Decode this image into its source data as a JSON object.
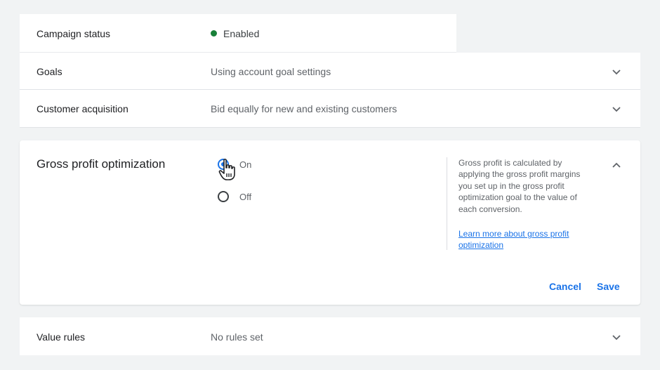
{
  "rows": {
    "campaign_status": {
      "label": "Campaign status",
      "value": "Enabled",
      "status_color": "#188038"
    },
    "goals": {
      "label": "Goals",
      "value": "Using account goal settings"
    },
    "customer_acquisition": {
      "label": "Customer acquisition",
      "value": "Bid equally for new and existing customers"
    },
    "value_rules": {
      "label": "Value rules",
      "value": "No rules set"
    }
  },
  "gross_profit": {
    "title": "Gross profit optimization",
    "options": [
      {
        "label": "On",
        "selected": true
      },
      {
        "label": "Off",
        "selected": false
      }
    ],
    "help_text": "Gross profit is calculated by applying the gross profit margins you set up in the gross profit optimization goal to the value of each conversion.",
    "help_link": "Learn more about gross profit optimization",
    "cancel_label": "Cancel",
    "save_label": "Save"
  },
  "icons": {
    "collapsed": "chevron-down-icon",
    "expanded": "chevron-up-icon",
    "pointer": "hand-cursor-icon"
  },
  "colors": {
    "accent": "#1a73e8",
    "status_enabled": "#188038"
  }
}
